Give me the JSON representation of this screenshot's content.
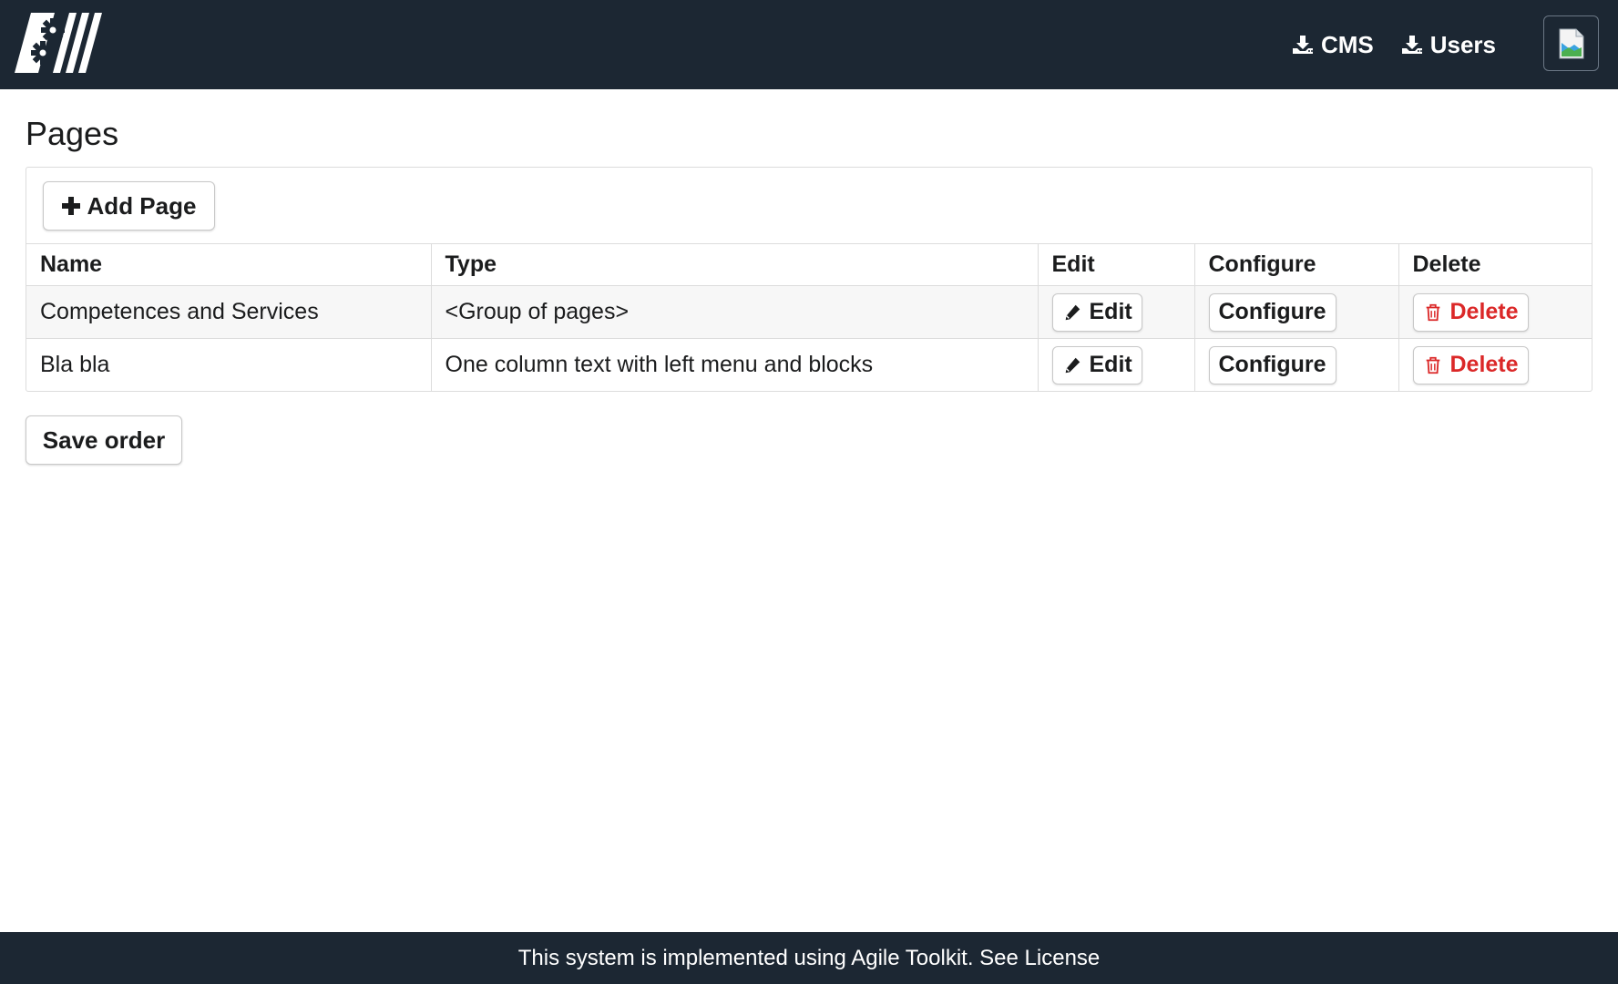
{
  "header": {
    "nav": [
      {
        "label": "CMS",
        "icon": "download-icon"
      },
      {
        "label": "Users",
        "icon": "download-icon"
      }
    ],
    "avatar_icon": "broken-image-icon"
  },
  "main": {
    "title": "Pages",
    "add_button": {
      "label": "Add Page",
      "icon": "plus-icon"
    },
    "table": {
      "columns": [
        "Name",
        "Type",
        "Edit",
        "Configure",
        "Delete"
      ],
      "rows": [
        {
          "name": "Competences and Services",
          "type": "<Group of pages>",
          "edit": "Edit",
          "configure": "Configure",
          "delete": "Delete"
        },
        {
          "name": "Bla bla",
          "type": "One column text with left menu and blocks",
          "edit": "Edit",
          "configure": "Configure",
          "delete": "Delete"
        }
      ]
    },
    "save_button": {
      "label": "Save order"
    }
  },
  "footer": {
    "text": "This system is implemented using Agile Toolkit. See License"
  },
  "colors": {
    "topbar": "#1c2733",
    "delete": "#db2828",
    "row_stripe": "#f7f7f7"
  }
}
